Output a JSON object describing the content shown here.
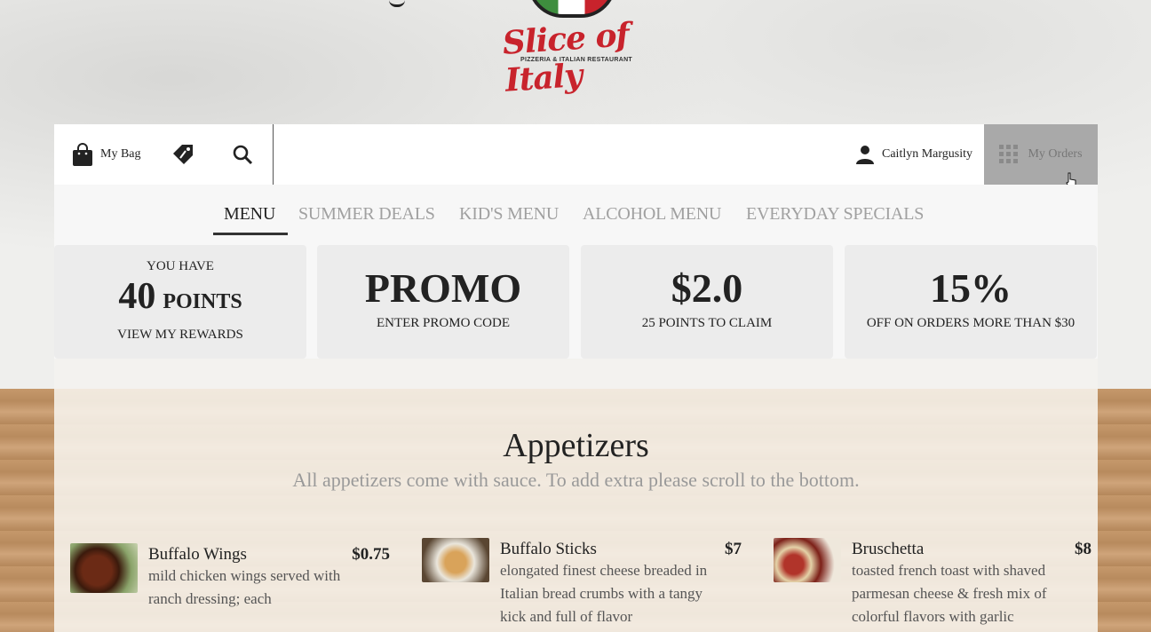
{
  "logo": {
    "script": "Slice of Italy",
    "subtitle": "PIZZERIA & ITALIAN RESTAURANT"
  },
  "topbar": {
    "bag_label": "My Bag",
    "user_name": "Caitlyn Margusity",
    "orders_label": "My Orders"
  },
  "tabs": [
    {
      "label": "MENU",
      "active": true
    },
    {
      "label": "SUMMER DEALS",
      "active": false
    },
    {
      "label": "KID'S MENU",
      "active": false
    },
    {
      "label": "ALCOHOL MENU",
      "active": false
    },
    {
      "label": "EVERYDAY SPECIALS",
      "active": false
    }
  ],
  "cards": {
    "points": {
      "you_have": "YOU HAVE",
      "count": "40",
      "unit": "POINTS",
      "link": "VIEW MY REWARDS"
    },
    "promo": {
      "big": "PROMO",
      "small": "ENTER PROMO CODE"
    },
    "claim": {
      "big": "$2.0",
      "small": "25 POINTS TO CLAIM"
    },
    "discount": {
      "big": "15%",
      "small": "OFF ON ORDERS MORE THAN $30"
    }
  },
  "section": {
    "title": "Appetizers",
    "subtitle": "All appetizers come with sauce. To add extra please scroll to the bottom."
  },
  "items": [
    {
      "name": "Buffalo Wings",
      "price": "$0.75",
      "desc": "mild chicken wings served with ranch dressing; each"
    },
    {
      "name": "Buffalo Sticks",
      "price": "$7",
      "desc": "elongated finest cheese breaded in Italian bread crumbs with a tangy kick and full of flavor"
    },
    {
      "name": "Bruschetta",
      "price": "$8",
      "desc": "toasted french toast with shaved parmesan cheese & fresh mix of colorful flavors with garlic"
    }
  ],
  "colors": {
    "brand_red": "#c8232c",
    "active_tab": "#222222",
    "inactive_tab": "#a0a0a0",
    "orders_bg": "#a9a9a9"
  }
}
